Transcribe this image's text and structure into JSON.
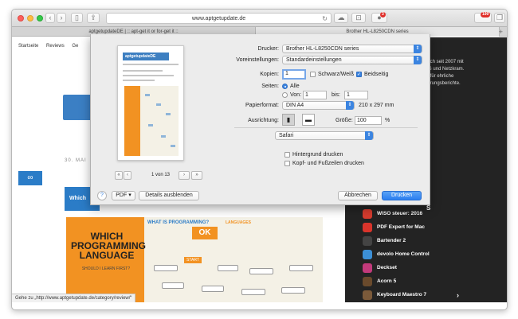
{
  "browser": {
    "url": "www.aptgetupdate.de",
    "badge_ext": "3",
    "badge_mail": "199",
    "tabs": [
      {
        "label": "aptgetupdateDE | :: apt-get it or for-get it ::"
      },
      {
        "label": "Brother HL-L8250CDN series"
      }
    ],
    "status": "Gehe zu „http://www.aptgetupdate.de/category/review/“"
  },
  "website": {
    "nav": [
      "Startseite",
      "Reviews",
      "Ge"
    ],
    "about_lines": [
      "E]",
      "auch seit 2007 mit",
      "OS und Netzkram.",
      "dafür ehrliche",
      "ahrungsberichte."
    ],
    "date": "30. MAI",
    "blue_block": "Which",
    "infographic": {
      "title": "WHICH PROGRAMMING LANGUAGE",
      "subtitle": "SHOULD I LEARN FIRST?",
      "what": "WHAT IS PROGRAMMING?",
      "ok": "OK",
      "languages": "LANGUAGES",
      "start": "START"
    },
    "sidebar_apps": [
      {
        "name": "WISO steuer: 2016",
        "color": "#d43b2e"
      },
      {
        "name": "PDF Expert for Mac",
        "color": "#d9342b"
      },
      {
        "name": "Bartender 2",
        "color": "#444444"
      },
      {
        "name": "devolo Home Control",
        "color": "#3c8fd6"
      },
      {
        "name": "Deckset",
        "color": "#c23a7b"
      },
      {
        "name": "Acorn 5",
        "color": "#6a4a2c"
      },
      {
        "name": "Keyboard Maestro 7",
        "color": "#7b5a3a"
      }
    ],
    "sidebar_partial": "S"
  },
  "print": {
    "preview_logo": "aptgetupdateDE",
    "page_of": "1 von 13",
    "labels": {
      "printer": "Drucker:",
      "presets": "Voreinstellungen:",
      "copies": "Kopien:",
      "pages": "Seiten:",
      "paper": "Papierformat:",
      "orientation": "Ausrichtung:",
      "scale": "Größe:"
    },
    "printer_value": "Brother HL-L8250CDN series",
    "presets_value": "Standardeinstellungen",
    "copies_value": "1",
    "bw_label": "Schwarz/Weiß",
    "duplex_label": "Beidseitig",
    "pages_all": "Alle",
    "pages_from": "Von:",
    "pages_from_value": "1",
    "pages_to": "bis:",
    "pages_to_value": "1",
    "paper_value": "DIN A4",
    "paper_size": "210 x 297 mm",
    "scale_value": "100",
    "scale_unit": "%",
    "app_section": "Safari",
    "bg_label": "Hintergrund drucken",
    "headers_label": "Kopf- und Fußzeilen drucken",
    "pdf_label": "PDF",
    "details_label": "Details ausblenden",
    "cancel_label": "Abbrechen",
    "print_label": "Drucken",
    "help_label": "?"
  }
}
